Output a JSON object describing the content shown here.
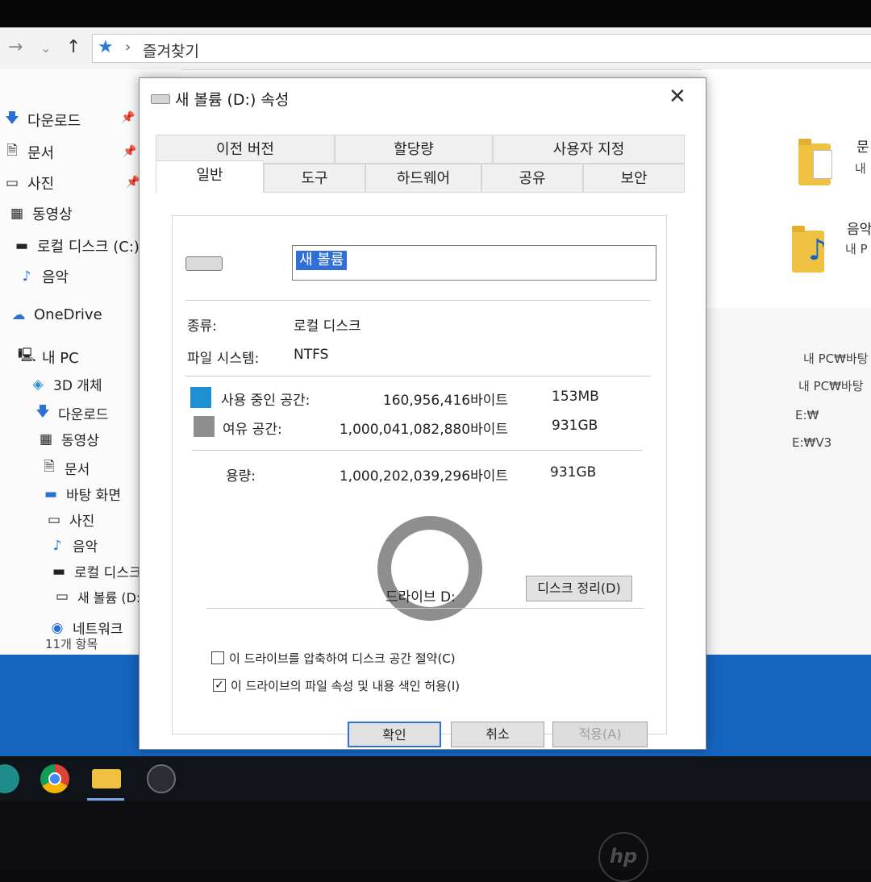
{
  "explorer": {
    "address": {
      "back_icon": "back-arrow-icon",
      "forward_icon": "chevron-down-icon",
      "up_icon": "up-arrow-icon",
      "path": "즐겨찾기"
    },
    "quick_access": [
      {
        "label": "다운로드",
        "icon": "download-icon",
        "pinned": true
      },
      {
        "label": "문서",
        "icon": "document-icon",
        "pinned": true
      },
      {
        "label": "사진",
        "icon": "pictures-icon",
        "pinned": true
      },
      {
        "label": "동영상",
        "icon": "video-icon"
      },
      {
        "label": "로컬 디스크 (C:)",
        "icon": "local-disk-icon"
      },
      {
        "label": "음악",
        "icon": "music-icon"
      }
    ],
    "onedrive": "OneDrive",
    "this_pc": "내 PC",
    "pc_items": [
      {
        "label": "3D 개체",
        "icon": "3d-objects-icon"
      },
      {
        "label": "다운로드",
        "icon": "download-icon"
      },
      {
        "label": "동영상",
        "icon": "video-icon"
      },
      {
        "label": "문서",
        "icon": "document-icon"
      },
      {
        "label": "바탕 화면",
        "icon": "desktop-icon"
      },
      {
        "label": "사진",
        "icon": "pictures-icon"
      },
      {
        "label": "음악",
        "icon": "music-icon"
      },
      {
        "label": "로컬 디스크 (C:)",
        "icon": "local-disk-icon"
      },
      {
        "label": "새 볼륨 (D:)",
        "icon": "drive-icon"
      }
    ],
    "network": "네트워크",
    "status": "11개 항목",
    "content": {
      "item1_name": "문",
      "item1_sub": "내",
      "item2_name": "음악",
      "item2_sub": "내 P",
      "paths": [
        "내 PC₩바탕",
        "내 PC₩바탕",
        "E:₩",
        "E:₩V3"
      ]
    }
  },
  "dialog": {
    "title": "새 볼륨 (D:) 속성",
    "close_icon": "close-icon",
    "tabs_row1": [
      "이전 버전",
      "할당량",
      "사용자 지정"
    ],
    "tabs_row2": [
      "일반",
      "도구",
      "하드웨어",
      "공유",
      "보안"
    ],
    "volume_name": "새 볼륨",
    "type_label": "종류:",
    "type_value": "로컬 디스크",
    "fs_label": "파일 시스템:",
    "fs_value": "NTFS",
    "used_label": "사용 중인 공간:",
    "used_bytes": "160,956,416바이트",
    "used_human": "153MB",
    "used_color": "#1e8fd0",
    "free_label": "여유 공간:",
    "free_bytes": "1,000,041,082,880바이트",
    "free_human": "931GB",
    "free_color": "#8e8e8e",
    "capacity_label": "용량:",
    "capacity_bytes": "1,000,202,039,296바이트",
    "capacity_human": "931GB",
    "drive_label": "드라이브 D:",
    "cleanup_button": "디스크 정리(D)",
    "compress_label": "이 드라이브를 압축하여 디스크 공간 절약(C)",
    "compress_checked": false,
    "index_label": "이 드라이브의 파일 속성 및 내용 색인 허용(I)",
    "index_checked": true,
    "ok_button": "확인",
    "cancel_button": "취소",
    "apply_button": "적용(A)"
  },
  "taskbar": {
    "items": [
      "cortana-icon",
      "chrome-icon",
      "file-explorer-icon",
      "app-icon"
    ]
  },
  "device": {
    "brand": "hp"
  }
}
